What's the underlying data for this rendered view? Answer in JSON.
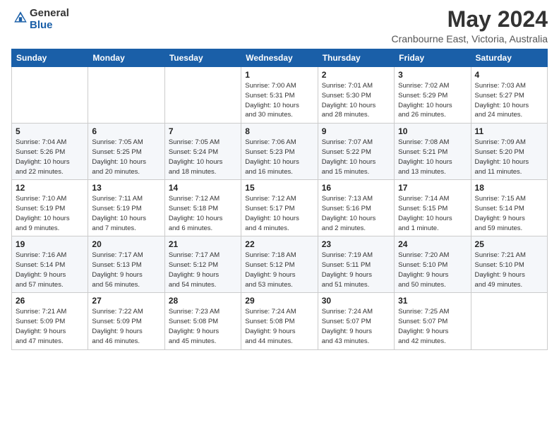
{
  "header": {
    "logo_line1": "General",
    "logo_line2": "Blue",
    "month": "May 2024",
    "location": "Cranbourne East, Victoria, Australia"
  },
  "weekdays": [
    "Sunday",
    "Monday",
    "Tuesday",
    "Wednesday",
    "Thursday",
    "Friday",
    "Saturday"
  ],
  "weeks": [
    [
      {
        "day": "",
        "info": ""
      },
      {
        "day": "",
        "info": ""
      },
      {
        "day": "",
        "info": ""
      },
      {
        "day": "1",
        "info": "Sunrise: 7:00 AM\nSunset: 5:31 PM\nDaylight: 10 hours\nand 30 minutes."
      },
      {
        "day": "2",
        "info": "Sunrise: 7:01 AM\nSunset: 5:30 PM\nDaylight: 10 hours\nand 28 minutes."
      },
      {
        "day": "3",
        "info": "Sunrise: 7:02 AM\nSunset: 5:29 PM\nDaylight: 10 hours\nand 26 minutes."
      },
      {
        "day": "4",
        "info": "Sunrise: 7:03 AM\nSunset: 5:27 PM\nDaylight: 10 hours\nand 24 minutes."
      }
    ],
    [
      {
        "day": "5",
        "info": "Sunrise: 7:04 AM\nSunset: 5:26 PM\nDaylight: 10 hours\nand 22 minutes."
      },
      {
        "day": "6",
        "info": "Sunrise: 7:05 AM\nSunset: 5:25 PM\nDaylight: 10 hours\nand 20 minutes."
      },
      {
        "day": "7",
        "info": "Sunrise: 7:05 AM\nSunset: 5:24 PM\nDaylight: 10 hours\nand 18 minutes."
      },
      {
        "day": "8",
        "info": "Sunrise: 7:06 AM\nSunset: 5:23 PM\nDaylight: 10 hours\nand 16 minutes."
      },
      {
        "day": "9",
        "info": "Sunrise: 7:07 AM\nSunset: 5:22 PM\nDaylight: 10 hours\nand 15 minutes."
      },
      {
        "day": "10",
        "info": "Sunrise: 7:08 AM\nSunset: 5:21 PM\nDaylight: 10 hours\nand 13 minutes."
      },
      {
        "day": "11",
        "info": "Sunrise: 7:09 AM\nSunset: 5:20 PM\nDaylight: 10 hours\nand 11 minutes."
      }
    ],
    [
      {
        "day": "12",
        "info": "Sunrise: 7:10 AM\nSunset: 5:19 PM\nDaylight: 10 hours\nand 9 minutes."
      },
      {
        "day": "13",
        "info": "Sunrise: 7:11 AM\nSunset: 5:19 PM\nDaylight: 10 hours\nand 7 minutes."
      },
      {
        "day": "14",
        "info": "Sunrise: 7:12 AM\nSunset: 5:18 PM\nDaylight: 10 hours\nand 6 minutes."
      },
      {
        "day": "15",
        "info": "Sunrise: 7:12 AM\nSunset: 5:17 PM\nDaylight: 10 hours\nand 4 minutes."
      },
      {
        "day": "16",
        "info": "Sunrise: 7:13 AM\nSunset: 5:16 PM\nDaylight: 10 hours\nand 2 minutes."
      },
      {
        "day": "17",
        "info": "Sunrise: 7:14 AM\nSunset: 5:15 PM\nDaylight: 10 hours\nand 1 minute."
      },
      {
        "day": "18",
        "info": "Sunrise: 7:15 AM\nSunset: 5:14 PM\nDaylight: 9 hours\nand 59 minutes."
      }
    ],
    [
      {
        "day": "19",
        "info": "Sunrise: 7:16 AM\nSunset: 5:14 PM\nDaylight: 9 hours\nand 57 minutes."
      },
      {
        "day": "20",
        "info": "Sunrise: 7:17 AM\nSunset: 5:13 PM\nDaylight: 9 hours\nand 56 minutes."
      },
      {
        "day": "21",
        "info": "Sunrise: 7:17 AM\nSunset: 5:12 PM\nDaylight: 9 hours\nand 54 minutes."
      },
      {
        "day": "22",
        "info": "Sunrise: 7:18 AM\nSunset: 5:12 PM\nDaylight: 9 hours\nand 53 minutes."
      },
      {
        "day": "23",
        "info": "Sunrise: 7:19 AM\nSunset: 5:11 PM\nDaylight: 9 hours\nand 51 minutes."
      },
      {
        "day": "24",
        "info": "Sunrise: 7:20 AM\nSunset: 5:10 PM\nDaylight: 9 hours\nand 50 minutes."
      },
      {
        "day": "25",
        "info": "Sunrise: 7:21 AM\nSunset: 5:10 PM\nDaylight: 9 hours\nand 49 minutes."
      }
    ],
    [
      {
        "day": "26",
        "info": "Sunrise: 7:21 AM\nSunset: 5:09 PM\nDaylight: 9 hours\nand 47 minutes."
      },
      {
        "day": "27",
        "info": "Sunrise: 7:22 AM\nSunset: 5:09 PM\nDaylight: 9 hours\nand 46 minutes."
      },
      {
        "day": "28",
        "info": "Sunrise: 7:23 AM\nSunset: 5:08 PM\nDaylight: 9 hours\nand 45 minutes."
      },
      {
        "day": "29",
        "info": "Sunrise: 7:24 AM\nSunset: 5:08 PM\nDaylight: 9 hours\nand 44 minutes."
      },
      {
        "day": "30",
        "info": "Sunrise: 7:24 AM\nSunset: 5:07 PM\nDaylight: 9 hours\nand 43 minutes."
      },
      {
        "day": "31",
        "info": "Sunrise: 7:25 AM\nSunset: 5:07 PM\nDaylight: 9 hours\nand 42 minutes."
      },
      {
        "day": "",
        "info": ""
      }
    ]
  ]
}
